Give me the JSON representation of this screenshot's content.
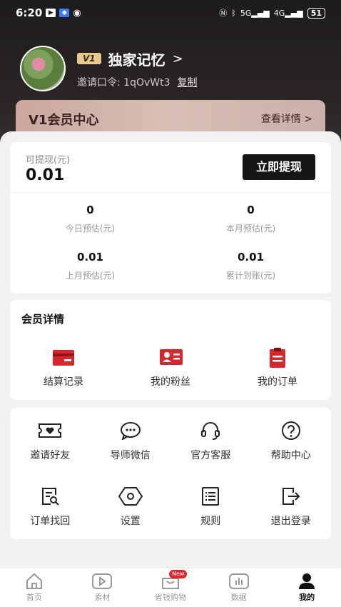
{
  "status_bar": {
    "time": "6:20",
    "battery": "51",
    "network_5g": "5G",
    "network_4g": "4G"
  },
  "profile": {
    "level_badge": "V1",
    "nickname": "独家记忆",
    "chevron": ">",
    "invite_label": "邀请口令: 1qOvWt3",
    "copy_label": "复制"
  },
  "vip": {
    "title": "V1会员中心",
    "detail_label": "查看详情 >"
  },
  "earnings": {
    "withdrawable_label": "可提现(元)",
    "withdrawable_amount": "0.01",
    "withdraw_button": "立即提现",
    "stats": [
      {
        "value": "0",
        "label": "今日预估(元)"
      },
      {
        "value": "0",
        "label": "本月预估(元)"
      },
      {
        "value": "0.01",
        "label": "上月预估(元)"
      },
      {
        "value": "0.01",
        "label": "累计到账(元)"
      }
    ]
  },
  "member": {
    "title": "会员详情",
    "items": [
      {
        "label": "结算记录",
        "icon": "settlement-icon"
      },
      {
        "label": "我的粉丝",
        "icon": "fans-icon"
      },
      {
        "label": "我的订单",
        "icon": "orders-icon"
      }
    ]
  },
  "tools": {
    "row1": [
      {
        "label": "邀请好友",
        "icon": "ticket-heart-icon"
      },
      {
        "label": "导师微信",
        "icon": "chat-icon"
      },
      {
        "label": "官方客服",
        "icon": "headset-icon"
      },
      {
        "label": "帮助中心",
        "icon": "help-icon"
      }
    ],
    "row2": [
      {
        "label": "订单找回",
        "icon": "order-search-icon"
      },
      {
        "label": "设置",
        "icon": "settings-icon"
      },
      {
        "label": "规则",
        "icon": "rules-icon"
      },
      {
        "label": "退出登录",
        "icon": "logout-icon"
      }
    ]
  },
  "tab_bar": {
    "new_badge": "New",
    "items": [
      {
        "label": "首页",
        "icon": "home-icon"
      },
      {
        "label": "素材",
        "icon": "play-icon"
      },
      {
        "label": "省钱购物",
        "icon": "shopping-bag-icon"
      },
      {
        "label": "数据",
        "icon": "data-icon"
      },
      {
        "label": "我的",
        "icon": "profile-icon"
      }
    ]
  },
  "colors": {
    "accent_red": "#e0242b",
    "dark": "#161616",
    "vip_gold": "#e9c98d"
  }
}
